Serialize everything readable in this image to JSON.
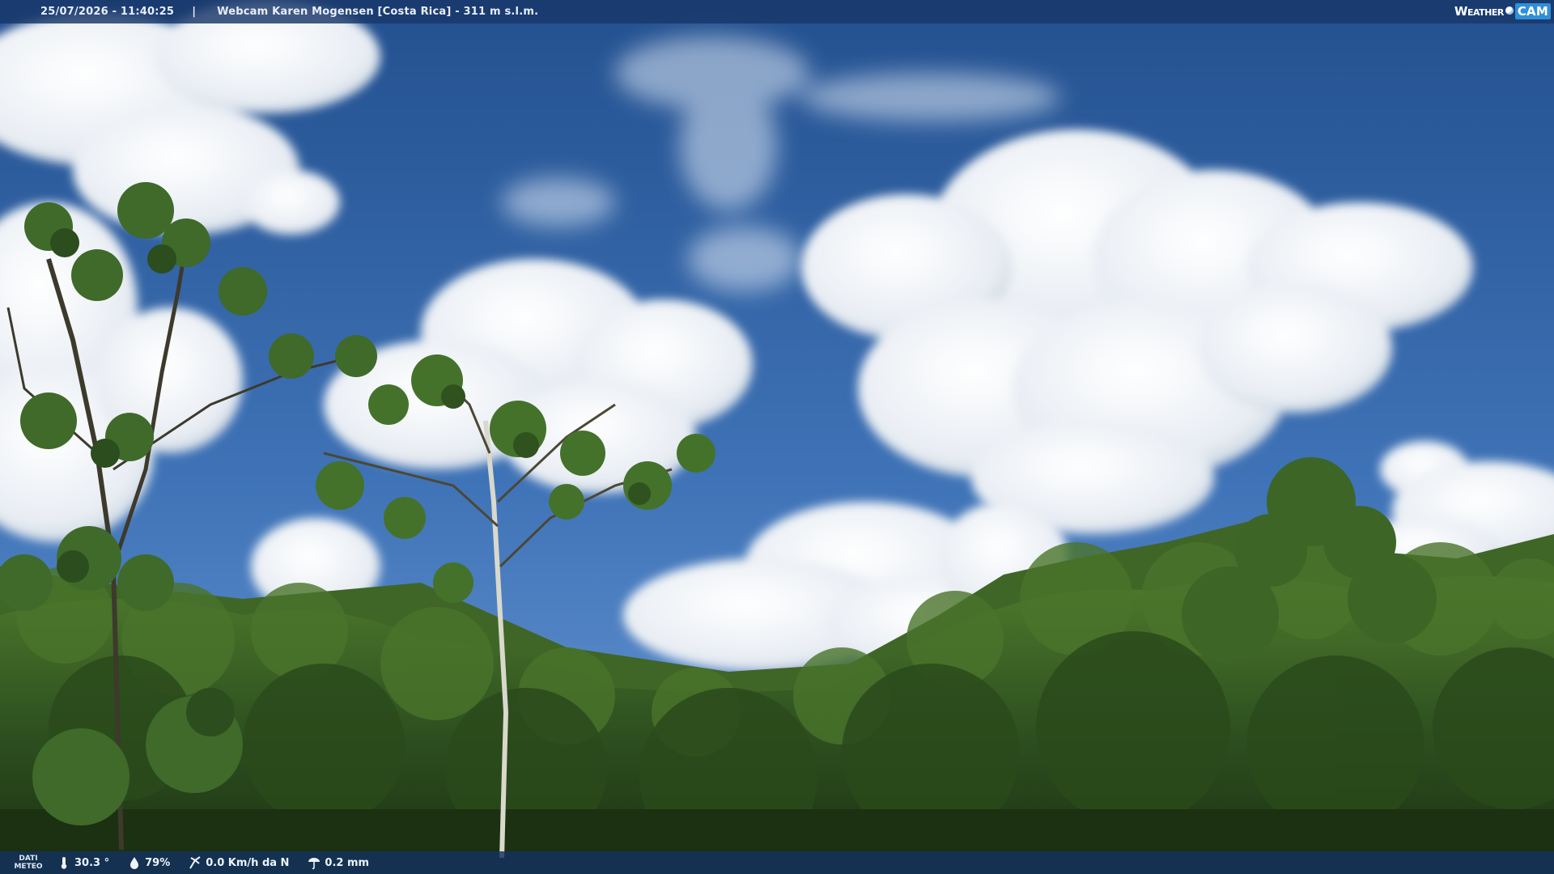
{
  "overlay": {
    "timestamp": "25/07/2026 - 11:40:25",
    "separator": "|",
    "title": "Webcam Karen Mogensen [Costa Rica]  - 311 m s.l.m.",
    "brand": {
      "weather": "Weather",
      "cam": "CAM"
    }
  },
  "weather": {
    "dati_label_1": "DATI",
    "dati_label_2": "METEO",
    "temperature": "30.3 °",
    "humidity": "79%",
    "wind": "0.0 Km/h da N",
    "rain": "0.2 mm",
    "icons": [
      "thermometer-icon",
      "humidity-drop-icon",
      "wind-icon",
      "rain-gauge-icon"
    ]
  },
  "colors": {
    "sky_top": "#244f8e",
    "sky_bottom": "#5d8ed0",
    "cloud": "#f2f5f9",
    "foliage_dark": "#1f3a16",
    "foliage_light": "#5e8a34",
    "bar": "#193769"
  }
}
